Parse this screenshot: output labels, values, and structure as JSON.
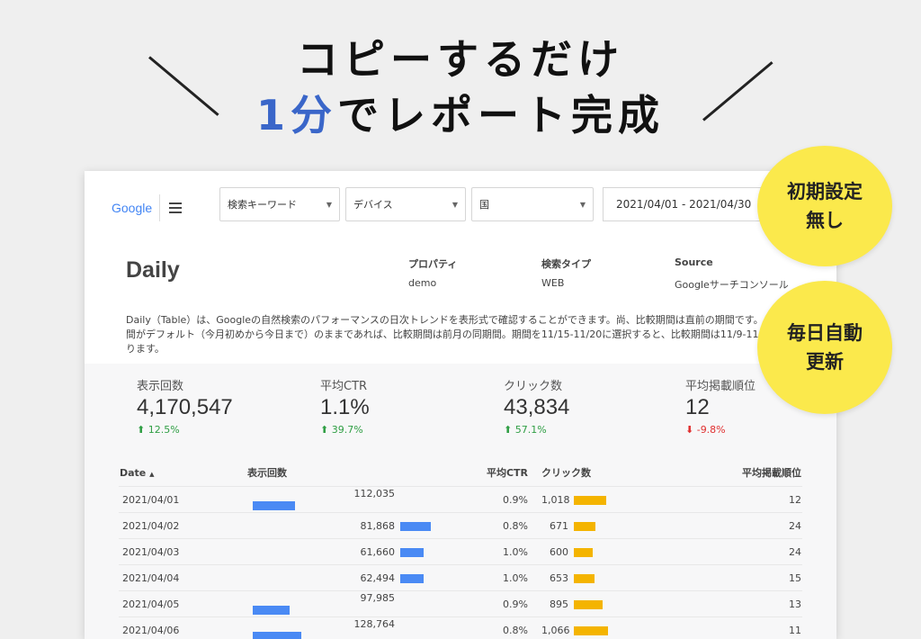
{
  "headline": {
    "line1": "コピーするだけ",
    "line2_accent": "1分",
    "line2_rest": "でレポート完成"
  },
  "report": {
    "brand": "Google",
    "filters": [
      {
        "label": "検索キーワード"
      },
      {
        "label": "デバイス"
      },
      {
        "label": "国"
      }
    ],
    "date_range": "2021/04/01 - 2021/04/30",
    "title": "Daily",
    "meta": [
      {
        "label": "プロパティ",
        "value": "demo"
      },
      {
        "label": "検索タイプ",
        "value": "WEB"
      },
      {
        "label": "Source",
        "value": "Googleサーチコンソール"
      }
    ],
    "description": "Daily（Table）は、Googleの自然検索のパフォーマンスの日次トレンドを表形式で確認することができます。尚、比較期間は直前の期間です。\n間がデフォルト（今月初めから今日まで）のままであれば、比較期間は前月の同期間。期間を11/15-11/20に選択すると、比較期間は11/9-11\nります。",
    "scorecards": [
      {
        "label": "表示回数",
        "value": "4,170,547",
        "delta": "12.5%",
        "direction": "up"
      },
      {
        "label": "平均CTR",
        "value": "1.1%",
        "delta": "39.7%",
        "direction": "up"
      },
      {
        "label": "クリック数",
        "value": "43,834",
        "delta": "57.1%",
        "direction": "up"
      },
      {
        "label": "平均掲載順位",
        "value": "12",
        "delta": "-9.8%",
        "direction": "down"
      }
    ],
    "table": {
      "headers": [
        "Date",
        "表示回数",
        "平均CTR",
        "クリック数",
        "平均掲載順位"
      ],
      "sort_indicator": "▲",
      "bar_colors": {
        "impressions": "#4a8af4",
        "clicks": "#f4b400"
      },
      "rows": [
        {
          "date": "2021/04/01",
          "impressions": "112,035",
          "impressions_n": 112035,
          "ctr": "0.9%",
          "clicks": "1,018",
          "clicks_n": 1018,
          "position": "12"
        },
        {
          "date": "2021/04/02",
          "impressions": "81,868",
          "impressions_n": 81868,
          "ctr": "0.8%",
          "clicks": "671",
          "clicks_n": 671,
          "position": "24"
        },
        {
          "date": "2021/04/03",
          "impressions": "61,660",
          "impressions_n": 61660,
          "ctr": "1.0%",
          "clicks": "600",
          "clicks_n": 600,
          "position": "24"
        },
        {
          "date": "2021/04/04",
          "impressions": "62,494",
          "impressions_n": 62494,
          "ctr": "1.0%",
          "clicks": "653",
          "clicks_n": 653,
          "position": "15"
        },
        {
          "date": "2021/04/05",
          "impressions": "97,985",
          "impressions_n": 97985,
          "ctr": "0.9%",
          "clicks": "895",
          "clicks_n": 895,
          "position": "13"
        },
        {
          "date": "2021/04/06",
          "impressions": "128,764",
          "impressions_n": 128764,
          "ctr": "0.8%",
          "clicks": "1,066",
          "clicks_n": 1066,
          "position": "11"
        }
      ]
    }
  },
  "badges": {
    "badge1_line1": "初期設定",
    "badge1_line2": "無し",
    "badge2_line1": "毎日自動",
    "badge2_line2": "更新"
  }
}
